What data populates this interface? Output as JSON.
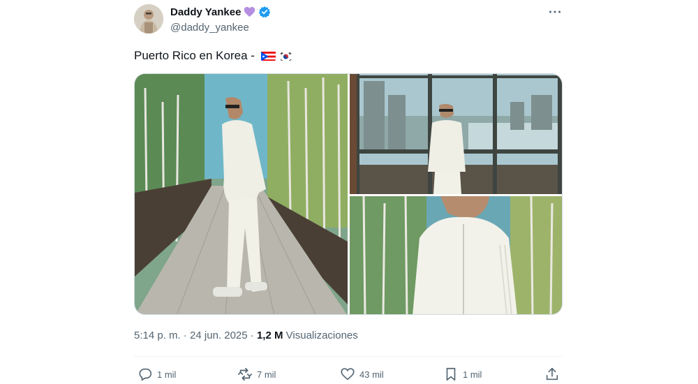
{
  "author": {
    "display_name": "Daddy Yankee",
    "handle": "@daddy_yankee",
    "verified": true,
    "badge_icon": "purple-heart-icon",
    "verified_color": "#1d9bf0"
  },
  "tweet": {
    "text": "Puerto Rico en Korea - ",
    "emojis": [
      "puerto-rico-flag-icon",
      "south-korea-flag-icon"
    ],
    "media_count": 3
  },
  "meta": {
    "time": "5:14 p. m.",
    "separator": "·",
    "date": "24 jun. 2025",
    "views_count": "1,2 M",
    "views_label": "Visualizaciones"
  },
  "actions": {
    "replies": "1 mil",
    "reposts": "7 mil",
    "likes": "43 mil",
    "bookmarks": "1 mil"
  },
  "colors": {
    "text_primary": "#0f1419",
    "text_secondary": "#536471",
    "border": "#cfd9de",
    "heart": "#b48ee0"
  }
}
